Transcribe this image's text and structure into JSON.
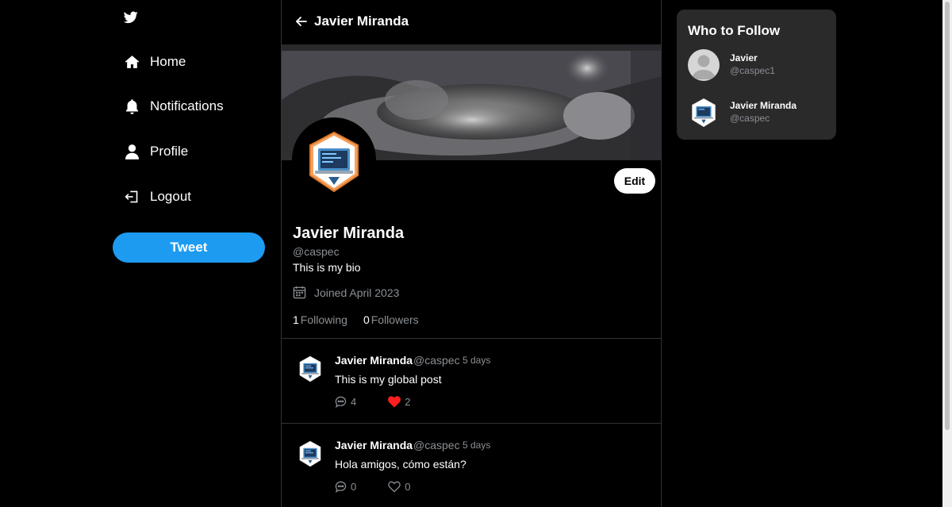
{
  "nav": {
    "items": [
      {
        "label": "Home",
        "icon": "home-icon"
      },
      {
        "label": "Notifications",
        "icon": "bell-icon"
      },
      {
        "label": "Profile",
        "icon": "user-icon"
      },
      {
        "label": "Logout",
        "icon": "logout-icon"
      }
    ],
    "tweet_button": "Tweet"
  },
  "header": {
    "title": "Javier Miranda"
  },
  "profile": {
    "name": "Javier Miranda",
    "handle": "@caspec",
    "bio": "This is my bio",
    "joined": "Joined April 2023",
    "following_count": "1",
    "following_label": "Following",
    "followers_count": "0",
    "followers_label": "Followers",
    "edit_button": "Edit"
  },
  "posts": [
    {
      "name": "Javier Miranda",
      "handle": "@caspec",
      "time": "5 days",
      "text": "This is my global post",
      "comments": "4",
      "likes": "2",
      "liked": true
    },
    {
      "name": "Javier Miranda",
      "handle": "@caspec",
      "time": "5 days",
      "text": "Hola amigos, cómo están?",
      "comments": "0",
      "likes": "0",
      "liked": false
    }
  ],
  "who_to_follow": {
    "title": "Who to Follow",
    "users": [
      {
        "name": "Javier",
        "handle": "@caspec1"
      },
      {
        "name": "Javier Miranda",
        "handle": "@caspec"
      }
    ]
  },
  "colors": {
    "accent": "#1d9bf0",
    "like": "#f91880",
    "muted": "#8b8f94",
    "panel": "#2a2a2a"
  }
}
